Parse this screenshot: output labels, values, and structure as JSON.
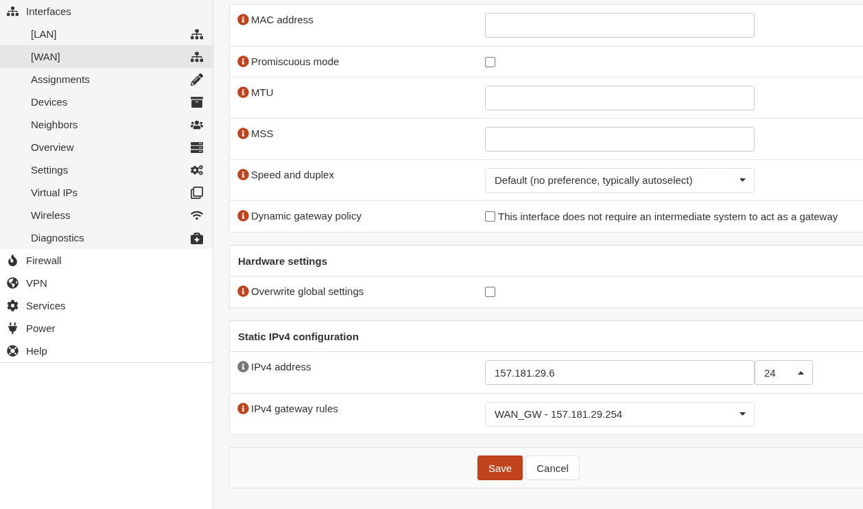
{
  "sidebar": {
    "items": [
      {
        "label": "Interfaces",
        "children": [
          {
            "label": "[LAN]",
            "selected": false
          },
          {
            "label": "[WAN]",
            "selected": true
          },
          {
            "label": "Assignments",
            "selected": false
          },
          {
            "label": "Devices",
            "selected": false
          },
          {
            "label": "Neighbors",
            "selected": false
          },
          {
            "label": "Overview",
            "selected": false
          },
          {
            "label": "Settings",
            "selected": false
          },
          {
            "label": "Virtual IPs",
            "selected": false
          },
          {
            "label": "Wireless",
            "selected": false
          },
          {
            "label": "Diagnostics",
            "selected": false
          }
        ]
      },
      {
        "label": "Firewall"
      },
      {
        "label": "VPN"
      },
      {
        "label": "Services"
      },
      {
        "label": "Power"
      },
      {
        "label": "Help"
      }
    ]
  },
  "sections": [
    {
      "rows": [
        {
          "kind": "input",
          "label": "MAC address",
          "color": "#c0431b"
        },
        {
          "kind": "checkbox",
          "label": "Promiscuous mode",
          "color": "#c0431b",
          "checked": false
        },
        {
          "kind": "input",
          "label": "MTU",
          "color": "#c0431b"
        },
        {
          "kind": "input",
          "label": "MSS",
          "color": "#c0431b"
        },
        {
          "kind": "select",
          "label": "Speed and duplex",
          "color": "#c0431b",
          "value": "Default (no preference, typically autoselect)"
        },
        {
          "kind": "checkbox",
          "label": "Dynamic gateway policy",
          "color": "#c0431b",
          "checked": false,
          "text": "This interface does not require an intermediate system to act as a gateway"
        }
      ]
    },
    {
      "title": "Hardware settings",
      "rows": [
        {
          "kind": "checkbox",
          "label": "Overwrite global settings",
          "color": "#c0431b",
          "checked": false
        }
      ]
    },
    {
      "title": "Static IPv4 configuration",
      "rows": [
        {
          "kind": "address",
          "label": "IPv4 address",
          "color": "#777777",
          "value": "157.181.29.6",
          "prefix": "24"
        },
        {
          "kind": "select",
          "label": "IPv4 gateway rules",
          "color": "#c0431b",
          "value": "WAN_GW - 157.181.29.254"
        }
      ]
    }
  ],
  "buttons": [
    {
      "label": "Save",
      "kind": "primary"
    },
    {
      "label": "Cancel",
      "kind": "default"
    }
  ]
}
